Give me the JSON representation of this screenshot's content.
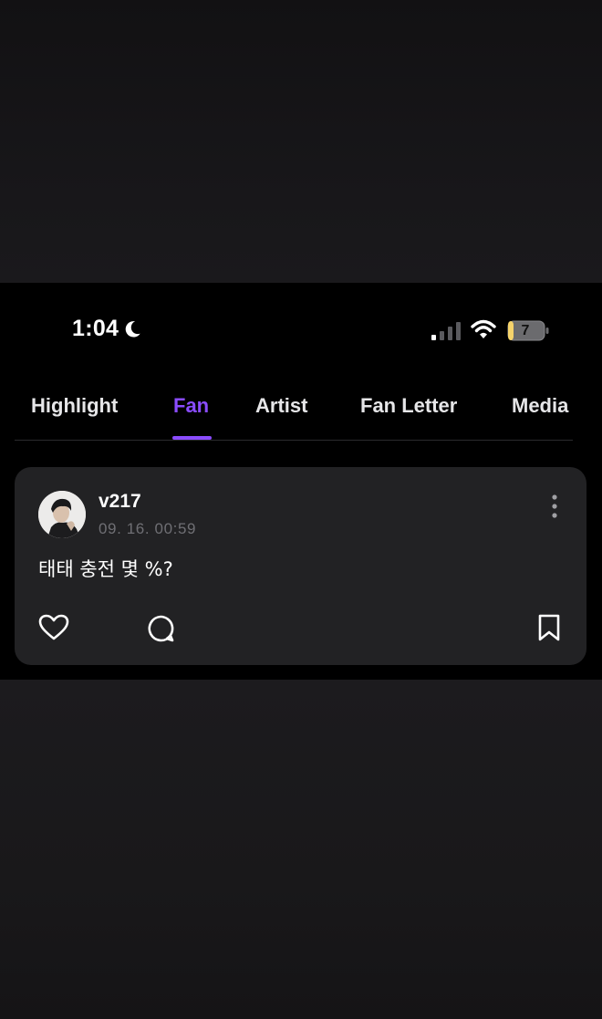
{
  "status_bar": {
    "time": "1:04",
    "battery_level": "7",
    "icons": [
      "moon-icon",
      "signal-icon",
      "wifi-icon",
      "battery-icon"
    ]
  },
  "tabs": [
    {
      "label": "Highlight",
      "active": false
    },
    {
      "label": "Fan",
      "active": true
    },
    {
      "label": "Artist",
      "active": false
    },
    {
      "label": "Fan Letter",
      "active": false
    },
    {
      "label": "Media",
      "active": false
    }
  ],
  "post": {
    "username": "v217",
    "timestamp": "09. 16. 00:59",
    "text": "태태 충전 몇 %?",
    "icons": [
      "avatar",
      "more-vertical-icon",
      "heart-icon",
      "comment-icon",
      "bookmark-icon"
    ]
  },
  "colors": {
    "accent": "#8a4cff",
    "card_bg": "#222224",
    "timestamp": "#6f6f74",
    "battery": "#f5d36b"
  }
}
